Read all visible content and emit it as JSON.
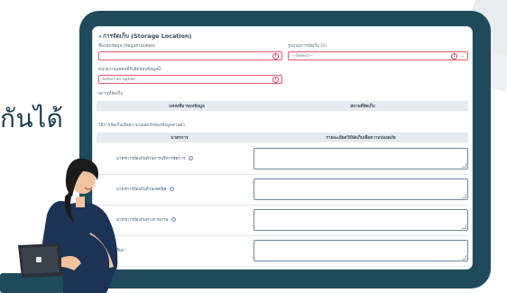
{
  "side_text": "กันได้",
  "form": {
    "title": "การจัดเก็บ (Storage Location)",
    "data_name_label": "ชื่อกลุ่มข้อมูล (ข้อมูลส่วนบุคคล)",
    "data_name_value": "",
    "storage_type_label": "รูปแบบการจัดเก็บ (0)",
    "storage_type_value": "---Select---",
    "responsible_label": "หน่วยงานบุคคลที่รับผิดชอบข้อมูลนี้",
    "responsible_value": "Select an option",
    "section_label": "สถานที่จัดเก็บ",
    "table1_col1": "แหล่งที่มาของข้อมูล",
    "table1_col2": "สถานที่จัดเก็บ",
    "measures_label": "วิธีการจัดเก็บเพื่อความปลอดภัยของข้อมูลส่วนตัว",
    "table2_col1": "มาตรการ",
    "table2_col2": "รายละเอียดวิธีจัดเก็บเพื่อความปลอดภัย",
    "rows": [
      {
        "label": "มาตรการป้องกันด้านการบริหารจัดการ",
        "value": ""
      },
      {
        "label": "มาตรการป้องกันด้านเทคนิค",
        "value": ""
      },
      {
        "label": "มาตรการป้องกันทางกายภาพ",
        "value": ""
      },
      {
        "label": "อื่นๆ",
        "value": ""
      }
    ],
    "info_glyph": "i",
    "error_glyph": "!",
    "chevron_glyph": "⌄"
  }
}
